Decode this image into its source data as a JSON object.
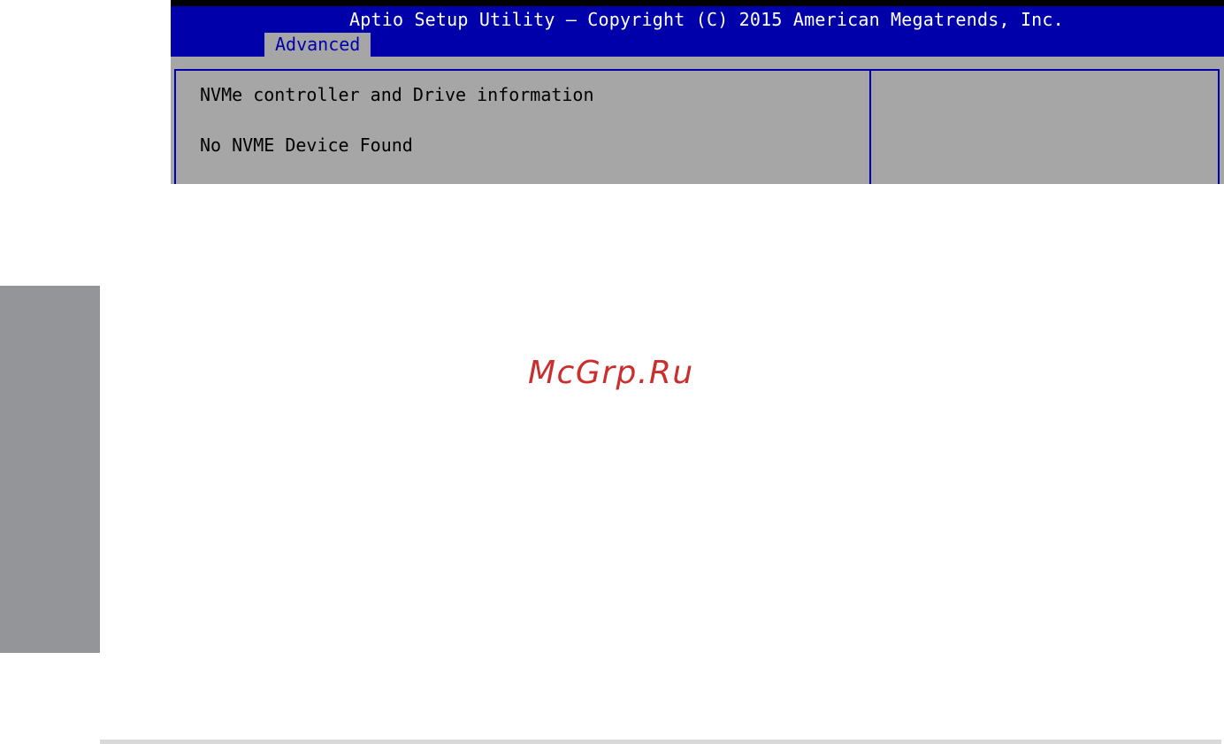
{
  "bios": {
    "title": "Aptio Setup Utility – Copyright (C) 2015 American Megatrends, Inc.",
    "active_tab": "Advanced",
    "main_lines": [
      "NVMe controller and Drive information",
      "No NVME Device Found"
    ]
  },
  "watermark": "McGrp.Ru",
  "colors": {
    "header_bg": "#0000aa",
    "panel_bg": "#a6a6a6",
    "title_text": "#ffffff",
    "tab_text": "#0000aa",
    "body_text": "#000000",
    "side_tab": "#939598",
    "watermark": "#cc2e2e"
  }
}
